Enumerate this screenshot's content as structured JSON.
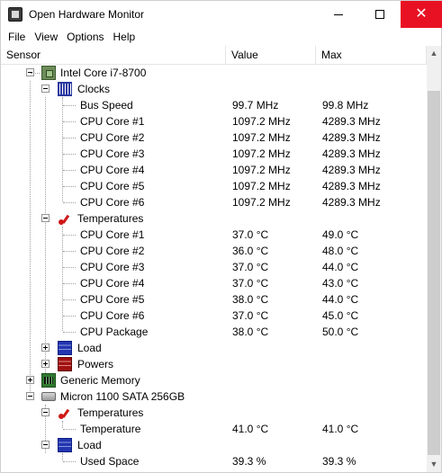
{
  "window": {
    "title": "Open Hardware Monitor"
  },
  "menu": [
    "File",
    "View",
    "Options",
    "Help"
  ],
  "columns": {
    "sensor": "Sensor",
    "value": "Value",
    "max": "Max"
  },
  "tree": {
    "cpu": {
      "name": "Intel Core i7-8700",
      "clocks": {
        "label": "Clocks",
        "items": [
          {
            "label": "Bus Speed",
            "value": "99.7 MHz",
            "max": "99.8 MHz"
          },
          {
            "label": "CPU Core #1",
            "value": "1097.2 MHz",
            "max": "4289.3 MHz"
          },
          {
            "label": "CPU Core #2",
            "value": "1097.2 MHz",
            "max": "4289.3 MHz"
          },
          {
            "label": "CPU Core #3",
            "value": "1097.2 MHz",
            "max": "4289.3 MHz"
          },
          {
            "label": "CPU Core #4",
            "value": "1097.2 MHz",
            "max": "4289.3 MHz"
          },
          {
            "label": "CPU Core #5",
            "value": "1097.2 MHz",
            "max": "4289.3 MHz"
          },
          {
            "label": "CPU Core #6",
            "value": "1097.2 MHz",
            "max": "4289.3 MHz"
          }
        ]
      },
      "temperatures": {
        "label": "Temperatures",
        "items": [
          {
            "label": "CPU Core #1",
            "value": "37.0 °C",
            "max": "49.0 °C"
          },
          {
            "label": "CPU Core #2",
            "value": "36.0 °C",
            "max": "48.0 °C"
          },
          {
            "label": "CPU Core #3",
            "value": "37.0 °C",
            "max": "44.0 °C"
          },
          {
            "label": "CPU Core #4",
            "value": "37.0 °C",
            "max": "43.0 °C"
          },
          {
            "label": "CPU Core #5",
            "value": "38.0 °C",
            "max": "44.0 °C"
          },
          {
            "label": "CPU Core #6",
            "value": "37.0 °C",
            "max": "45.0 °C"
          },
          {
            "label": "CPU Package",
            "value": "38.0 °C",
            "max": "50.0 °C"
          }
        ]
      },
      "load": {
        "label": "Load"
      },
      "powers": {
        "label": "Powers"
      }
    },
    "memory": {
      "name": "Generic Memory"
    },
    "disk": {
      "name": "Micron 1100 SATA 256GB",
      "temperatures": {
        "label": "Temperatures",
        "items": [
          {
            "label": "Temperature",
            "value": "41.0 °C",
            "max": "41.0 °C"
          }
        ]
      },
      "load": {
        "label": "Load",
        "items": [
          {
            "label": "Used Space",
            "value": "39.3 %",
            "max": "39.3 %"
          }
        ]
      }
    }
  },
  "colors": {
    "close_button": "#e81123",
    "scroll_thumb": "#cdcdcd"
  }
}
